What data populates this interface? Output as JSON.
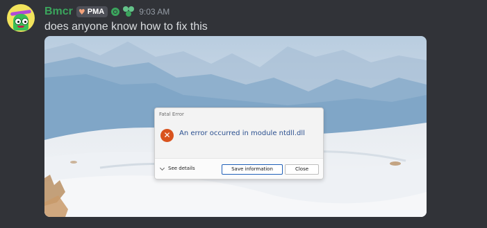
{
  "message": {
    "username": "Bmcr",
    "tag": "PMA",
    "timestamp": "9:03 AM",
    "text": "does anyone know how to fix this",
    "colors": {
      "username": "#3ba55d",
      "background": "#313338",
      "text": "#dbdee1"
    }
  },
  "attachment": {
    "dialog": {
      "title": "Fatal Error",
      "message": "An error occurred in module ntdll.dll",
      "see_details": "See details",
      "save_button": "Save information",
      "close_button": "Close",
      "icon": "error-x-icon",
      "colors": {
        "icon": "#d9531e",
        "message": "#2a4f8f"
      }
    }
  }
}
